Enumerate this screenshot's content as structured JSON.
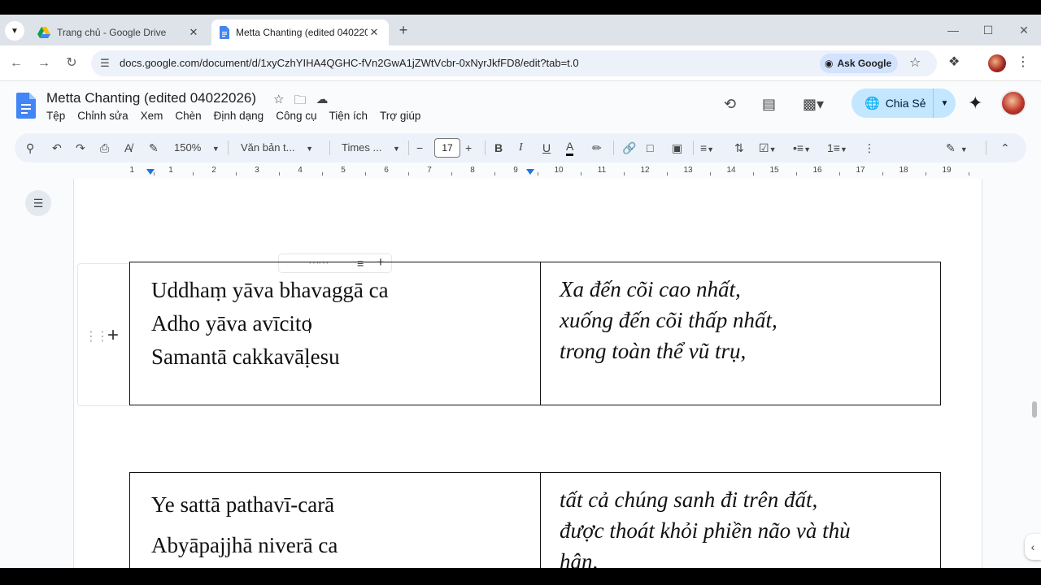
{
  "browser": {
    "tabs": [
      {
        "title": "Trang chủ - Google Drive",
        "active": false
      },
      {
        "title": "Metta Chanting (edited 040220",
        "active": true
      }
    ],
    "url": "docs.google.com/document/d/1xyCzhYIHA4QGHC-fVn2GwA1jZWtVcbr-0xNyrJkfFD8/edit?tab=t.0",
    "ask_google_label": "Ask Google"
  },
  "docs": {
    "title": "Metta Chanting (edited 04022026)",
    "menu": [
      "Tệp",
      "Chỉnh sửa",
      "Xem",
      "Chèn",
      "Định dạng",
      "Công cụ",
      "Tiện ích",
      "Trợ giúp"
    ],
    "share_label": "Chia Sẻ"
  },
  "toolbar": {
    "zoom": "150%",
    "style": "Văn bản t...",
    "font": "Times ...",
    "font_size": "17"
  },
  "ruler": {
    "labels": [
      "1",
      "1",
      "2",
      "3",
      "4",
      "5",
      "6",
      "7",
      "8",
      "9",
      "10",
      "11",
      "12",
      "13",
      "14",
      "15",
      "16",
      "17",
      "18",
      "19"
    ]
  },
  "table1": {
    "pali": [
      "Uddhaṃ yāva bhavaggā ca",
      "Adho yāva avīcito",
      "Samantā cakkavāḷesu"
    ],
    "viet": [
      "Xa đến cõi cao nhất,",
      "xuống đến cõi thấp nhất,",
      "trong toàn thể vũ trụ,"
    ]
  },
  "table2": {
    "pali": [
      "Ye sattā pathavī-carā",
      "Abyāpajjhā niverā ca"
    ],
    "viet": [
      "tất cả chúng sanh đi trên đất,",
      "được thoát khỏi phiền não và thù",
      "hận,"
    ]
  },
  "colors": {
    "accent": "#1a73e8",
    "share_bg": "#c2e7ff",
    "toolbar_bg": "#edf2fa",
    "chrome_bg": "#dee3ea"
  }
}
